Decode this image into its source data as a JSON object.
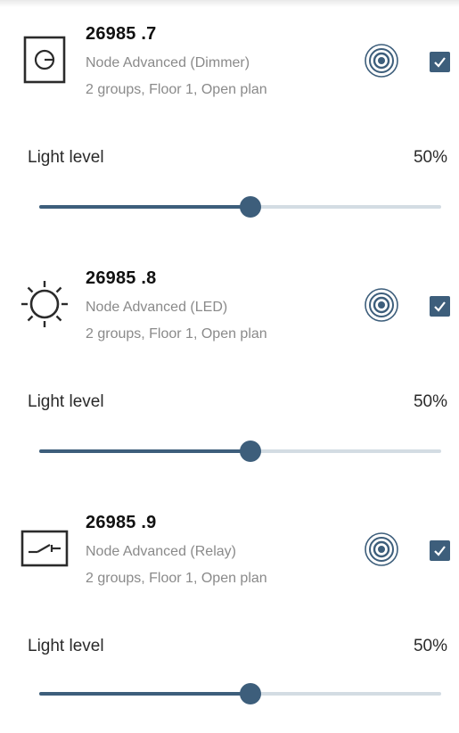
{
  "colors": {
    "accent": "#3d5e7b",
    "track": "#d3dce3",
    "secondary_text": "#8a8a8a"
  },
  "nodes": [
    {
      "id": "26985 .7",
      "type": "Node Advanced (Dimmer)",
      "groups": "2 groups, Floor 1, Open plan",
      "icon": "dimmer-icon",
      "selected": true,
      "level_label": "Light level",
      "level_value": "50%",
      "level_fraction": 0.525
    },
    {
      "id": "26985 .8",
      "type": "Node Advanced (LED)",
      "groups": "2 groups, Floor 1, Open plan",
      "icon": "led-icon",
      "selected": true,
      "level_label": "Light level",
      "level_value": "50%",
      "level_fraction": 0.525
    },
    {
      "id": "26985 .9",
      "type": "Node Advanced (Relay)",
      "groups": "2 groups, Floor 1, Open plan",
      "icon": "relay-icon",
      "selected": true,
      "level_label": "Light level",
      "level_value": "50%",
      "level_fraction": 0.525
    }
  ]
}
